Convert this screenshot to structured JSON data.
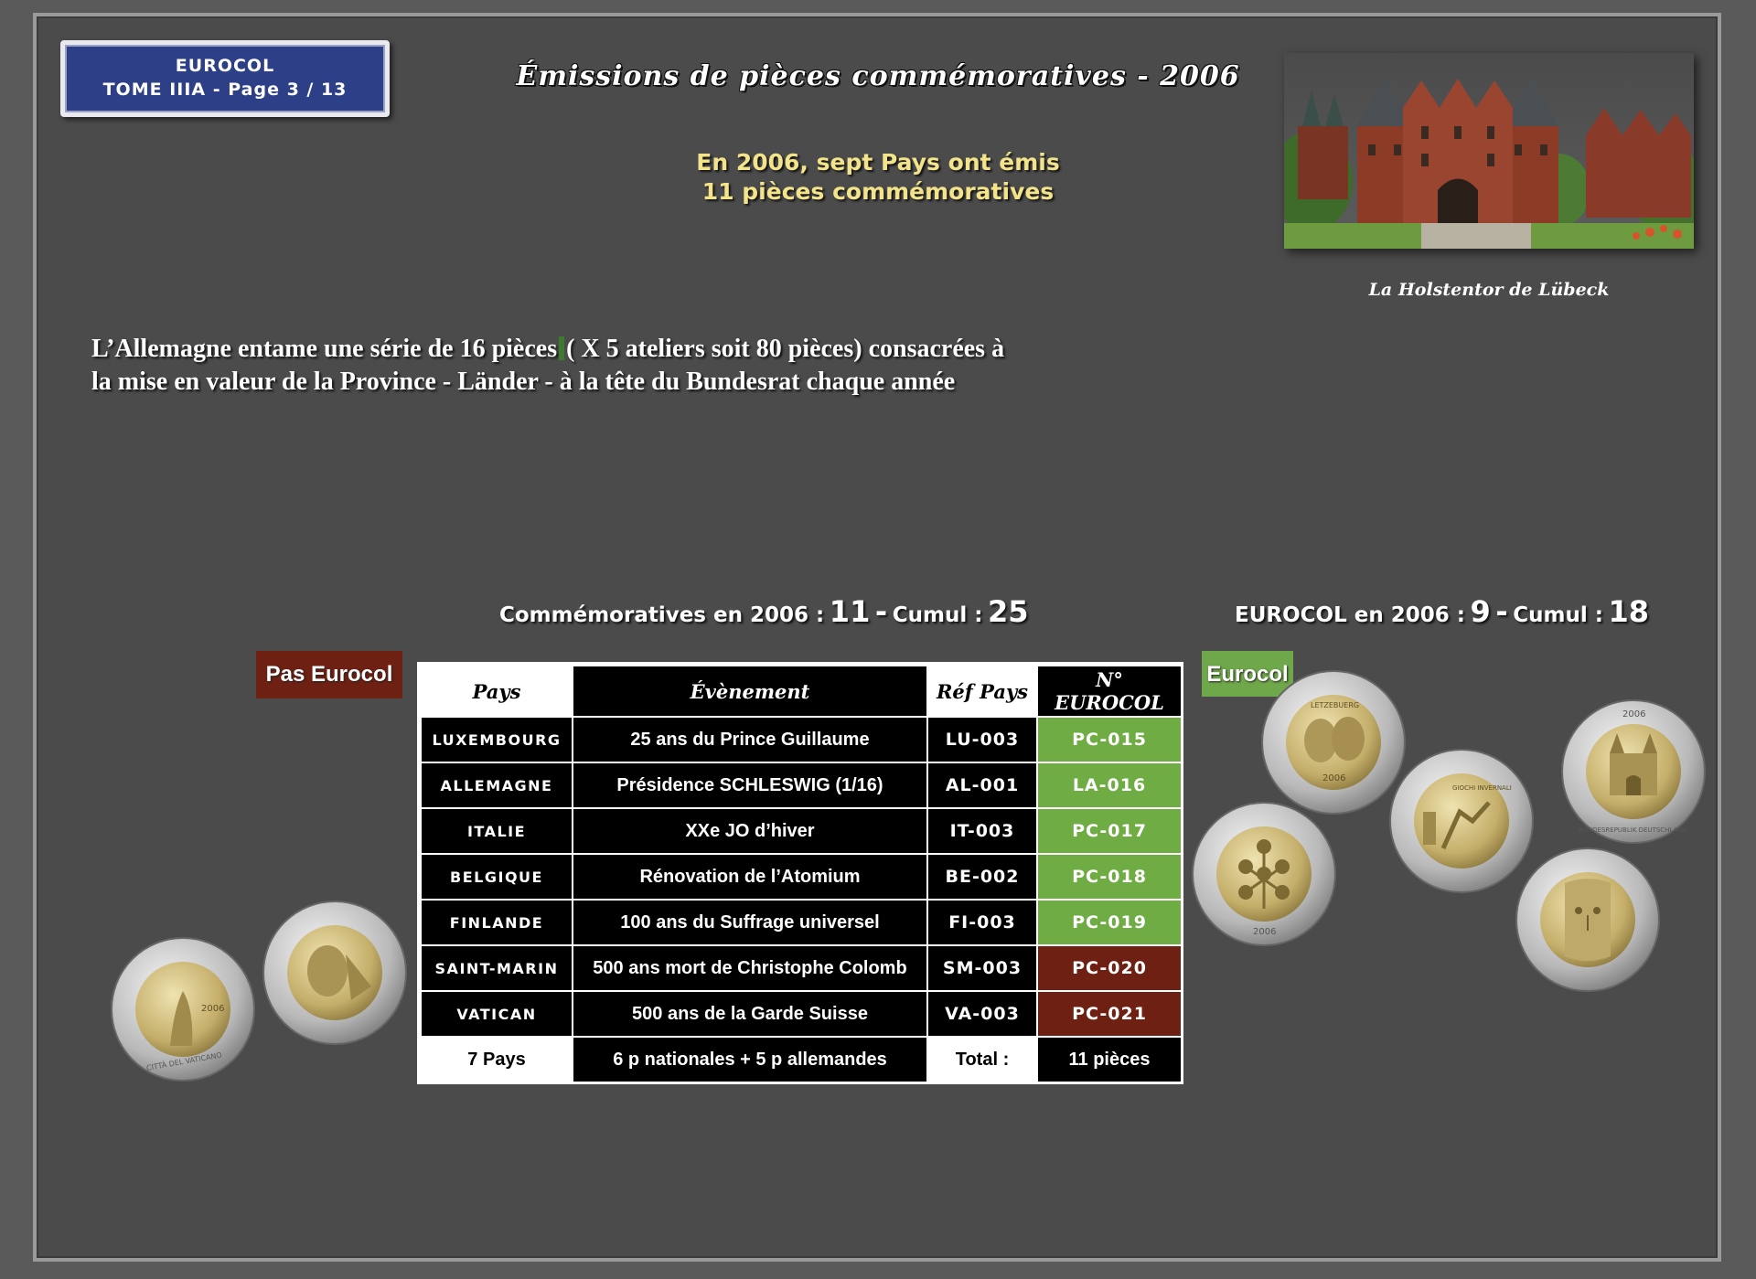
{
  "header": {
    "tome_line1": "EUROCOL",
    "tome_line2": "TOME IIIA - Page 3  / 13",
    "title": "Émissions de pièces commémoratives - 2006",
    "subtitle_line1": "En 2006, sept Pays ont émis",
    "subtitle_line2": "11 pièces commémoratives"
  },
  "photo": {
    "caption": "La Holstentor de Lübeck"
  },
  "intro": {
    "line1_a": "L’Allemagne entame une série de 16 pièces",
    "line1_b": "( X 5 ateliers soit 80 pièces) consacrées à",
    "line2": "la mise en valeur de la Province  - Länder - à la tête du Bundesrat chaque année"
  },
  "stats": {
    "comm_label": "Commémoratives en 2006 :",
    "comm_value": "11",
    "dash": "-",
    "cumul_label": "Cumul :",
    "comm_cumul": "25",
    "eurocol_label": "EUROCOL en 2006 :",
    "eurocol_value": "9",
    "eurocol_cumul": "18"
  },
  "tags": {
    "not_eurocol": "Pas Eurocol",
    "eurocol": "Eurocol"
  },
  "table": {
    "headers": [
      "Pays",
      "Évènement",
      "Réf Pays",
      "N° EUROCOL"
    ],
    "rows": [
      {
        "country": "LUXEMBOURG",
        "event": "25 ans du Prince Guillaume",
        "ref": "LU-003",
        "num": "PC-015",
        "status": "green"
      },
      {
        "country": "ALLEMAGNE",
        "event": "Présidence SCHLESWIG (1/16)",
        "ref": "AL-001",
        "num": "LA-016",
        "status": "green"
      },
      {
        "country": "ITALIE",
        "event": "XXe JO d’hiver",
        "ref": "IT-003",
        "num": "PC-017",
        "status": "green"
      },
      {
        "country": "BELGIQUE",
        "event": "Rénovation de l’Atomium",
        "ref": "BE-002",
        "num": "PC-018",
        "status": "green"
      },
      {
        "country": "FINLANDE",
        "event": "100 ans du Suffrage universel",
        "ref": "FI-003",
        "num": "PC-019",
        "status": "green"
      },
      {
        "country": "SAINT-MARIN",
        "event": "500 ans mort de Christophe Colomb",
        "ref": "SM-003",
        "num": "PC-020",
        "status": "red"
      },
      {
        "country": "VATICAN",
        "event": "500 ans de la Garde Suisse",
        "ref": "VA-003",
        "num": "PC-021",
        "status": "red"
      }
    ],
    "footer": [
      "7 Pays",
      "6 p nationales + 5 p allemandes",
      "Total :",
      "11 pièces"
    ]
  },
  "coins": {
    "lux_year": "2006",
    "lux_text": "LETZEBUERG",
    "be_year": "2006",
    "de_year": "2006",
    "de_text": "BUNDESREPUBLIK DEUTSCHLAND",
    "it_text": "GIOCHI INVERNALI",
    "va_year": "2006",
    "va_text": "CITTÀ DEL VATICANO"
  },
  "colors": {
    "green": "#6fac43",
    "red": "#6e2012",
    "navy": "#2d3f86",
    "gold": "#f3e38a"
  }
}
